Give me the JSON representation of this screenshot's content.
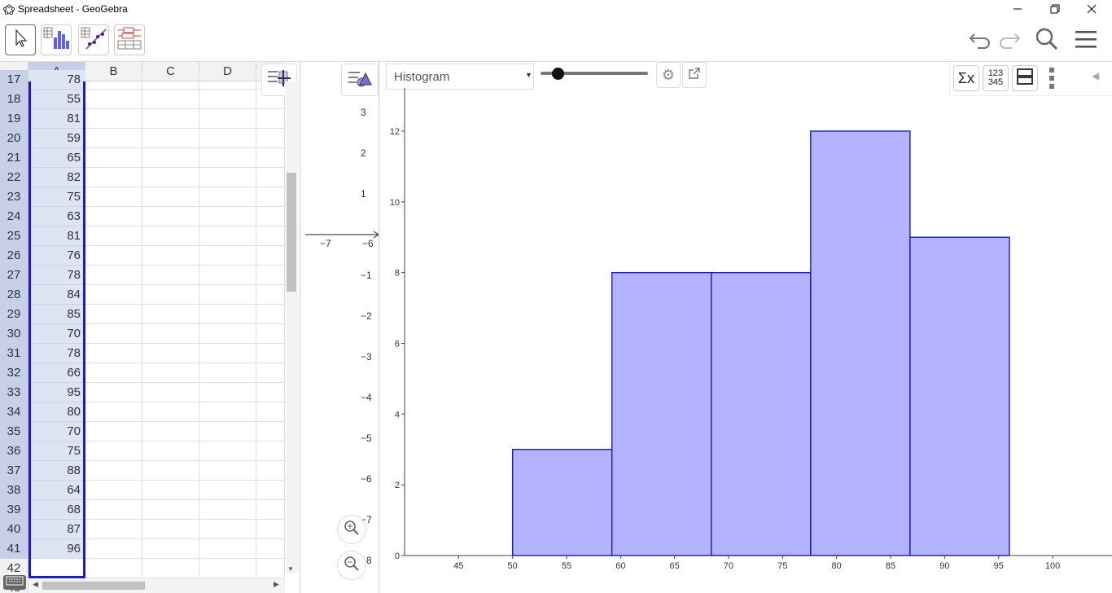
{
  "window": {
    "title": "Spreadsheet - GeoGebra"
  },
  "toolbar": {
    "tools": [
      "move-tool",
      "one-variable-analysis-tool",
      "two-variable-regression-tool",
      "multiple-variable-analysis-tool"
    ]
  },
  "spreadsheet": {
    "columns": [
      "A",
      "B",
      "C",
      "D"
    ],
    "partial_top_row": {
      "row": "17",
      "value": "78"
    },
    "rows": [
      {
        "row": "18",
        "value": "55"
      },
      {
        "row": "19",
        "value": "81"
      },
      {
        "row": "20",
        "value": "59"
      },
      {
        "row": "21",
        "value": "65"
      },
      {
        "row": "22",
        "value": "82"
      },
      {
        "row": "23",
        "value": "75"
      },
      {
        "row": "24",
        "value": "63"
      },
      {
        "row": "25",
        "value": "81"
      },
      {
        "row": "26",
        "value": "76"
      },
      {
        "row": "27",
        "value": "78"
      },
      {
        "row": "28",
        "value": "84"
      },
      {
        "row": "29",
        "value": "85"
      },
      {
        "row": "30",
        "value": "70"
      },
      {
        "row": "31",
        "value": "78"
      },
      {
        "row": "32",
        "value": "66"
      },
      {
        "row": "33",
        "value": "95"
      },
      {
        "row": "34",
        "value": "80"
      },
      {
        "row": "35",
        "value": "70"
      },
      {
        "row": "36",
        "value": "75"
      },
      {
        "row": "37",
        "value": "88"
      },
      {
        "row": "38",
        "value": "64"
      },
      {
        "row": "39",
        "value": "68"
      },
      {
        "row": "40",
        "value": "87"
      },
      {
        "row": "41",
        "value": "96"
      }
    ],
    "trailing_rows": [
      "42",
      "43"
    ]
  },
  "graphics": {
    "y_ticks": [
      "3",
      "2",
      "1",
      "−1",
      "−2",
      "−3",
      "−4",
      "−5",
      "−6",
      "−7",
      "−8"
    ],
    "x_ticks": [
      "−7",
      "−6"
    ]
  },
  "analysis": {
    "plot_type": "Histogram",
    "plot_type_options": [
      "Histogram"
    ]
  },
  "chart_data": {
    "type": "bar",
    "title": "",
    "xlabel": "",
    "ylabel": "",
    "bins": [
      [
        50,
        59.2
      ],
      [
        59.2,
        68.4
      ],
      [
        68.4,
        77.6
      ],
      [
        77.6,
        86.8
      ],
      [
        86.8,
        96
      ]
    ],
    "values": [
      3,
      8,
      8,
      12,
      9
    ],
    "x_ticks": [
      45,
      50,
      55,
      60,
      65,
      70,
      75,
      80,
      85,
      90,
      95,
      100
    ],
    "y_ticks": [
      0,
      2,
      4,
      6,
      8,
      10,
      12
    ],
    "xlim": [
      40,
      105.5
    ],
    "ylim": [
      0,
      13
    ],
    "bar_fill": "#b3b3ff",
    "bar_stroke": "#1a1acc",
    "grid": false
  },
  "colors": {
    "selection": "#c7d0e8",
    "selection_border": "#1a1ad6",
    "accent": "#6557d2"
  }
}
